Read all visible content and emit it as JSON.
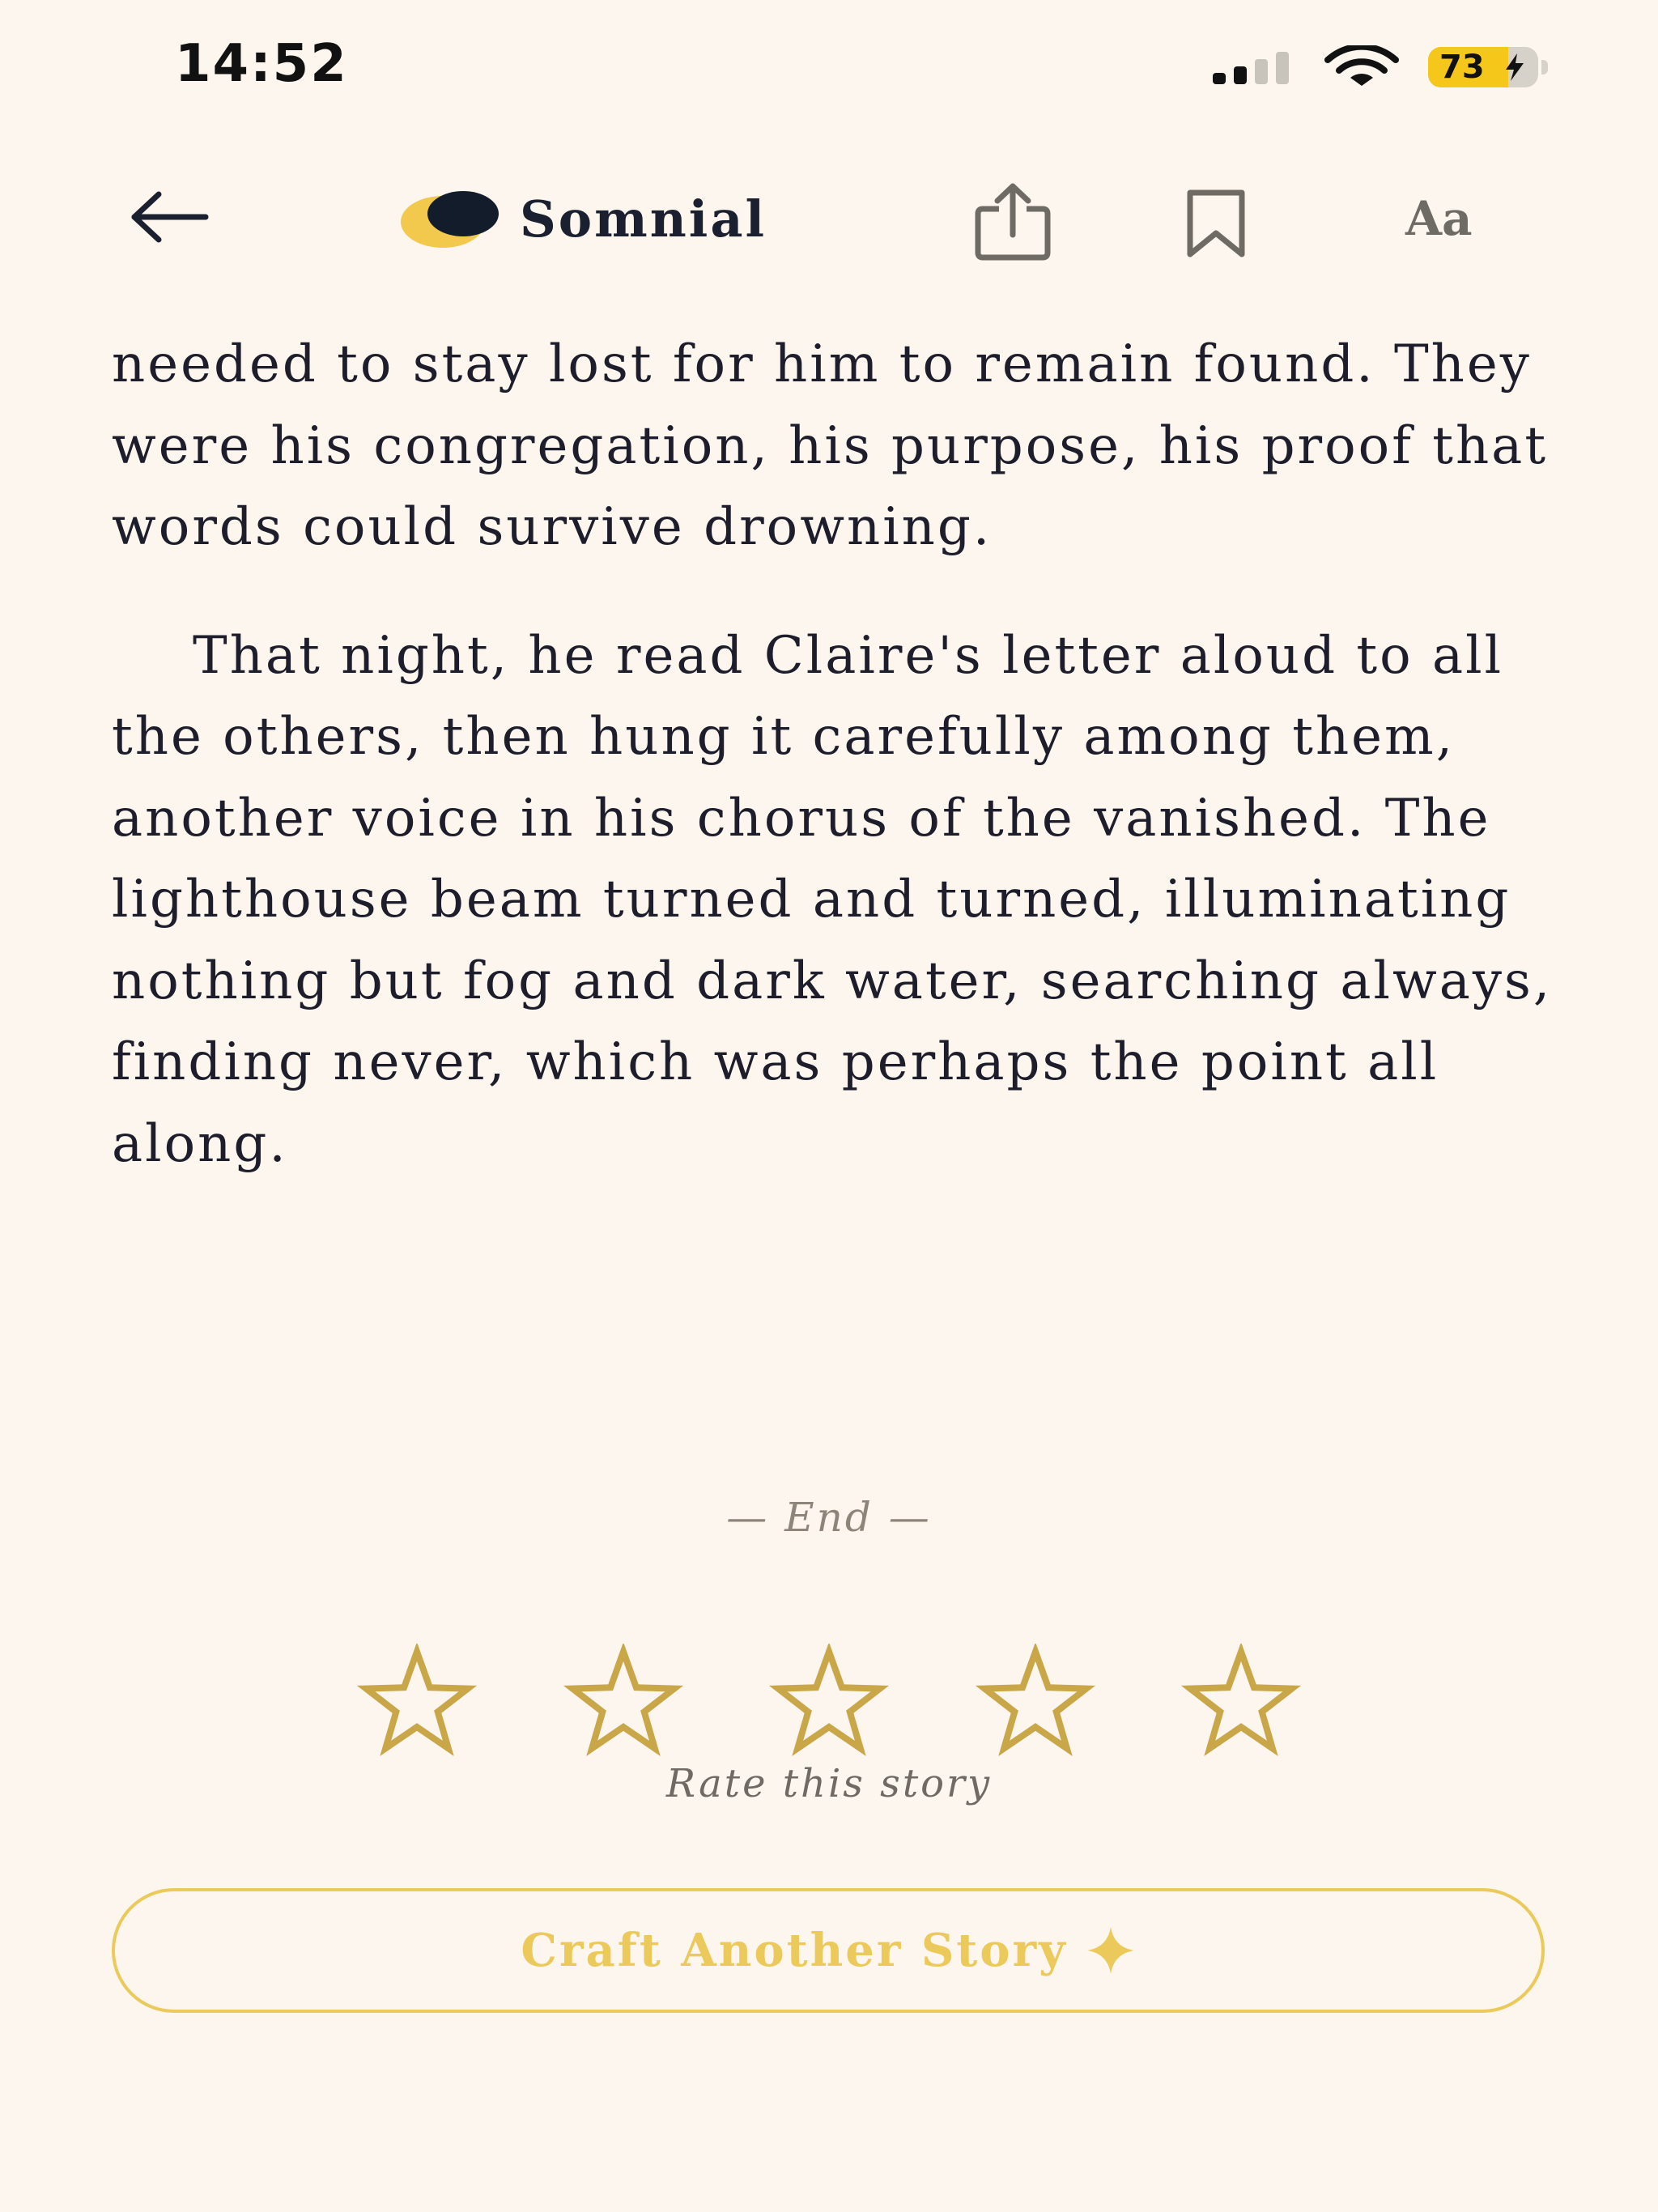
{
  "status_bar": {
    "time": "14:52",
    "battery_percent": "73",
    "battery_level": 0.73,
    "signal_bars_active": 2,
    "signal_bars_total": 4
  },
  "header": {
    "back_icon": "arrow-left-icon",
    "logo_icon": "moon-eclipse-icon",
    "brand_name": "Somnial",
    "share_icon": "share-icon",
    "bookmark_icon": "bookmark-icon",
    "font_settings_label": "Aa"
  },
  "story": {
    "paragraphs": [
      "needed to stay lost for him to remain found. They were his congregation, his purpose, his proof that words could survive drowning.",
      "That night, he read Claire's letter aloud to all the others, then hung it carefully among them, another voice in his chorus of the vanished. The lighthouse beam turned and turned, illuminating nothing but fog and dark water, searching always, finding never, which was perhaps the point all along."
    ]
  },
  "footer": {
    "end_marker": "— End —",
    "rating": {
      "max": 5,
      "value": 0,
      "label": "Rate this story"
    },
    "craft_button_label": "Craft Another Story",
    "craft_icon": "sparkle-icon"
  },
  "colors": {
    "background": "#fdf6ee",
    "text": "#1d1d2b",
    "accent_gold": "#ebc95a",
    "star_gold": "#c9a647",
    "muted": "#8d857a"
  }
}
